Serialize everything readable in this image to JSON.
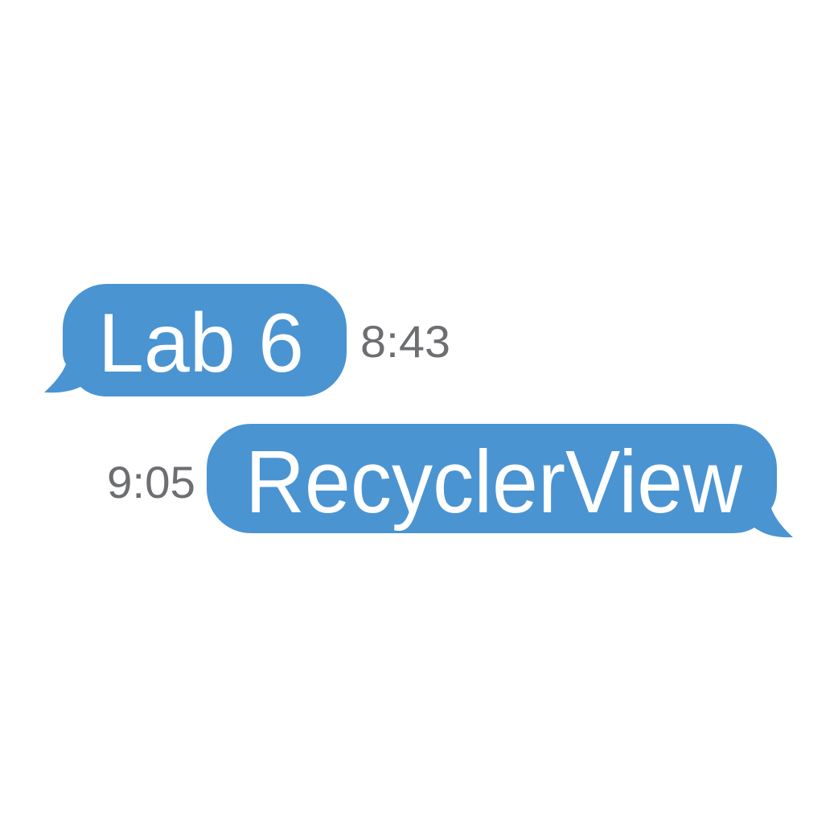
{
  "colors": {
    "bubble": "#4A94D2",
    "bubble_text": "#FFFFFF",
    "timestamp": "#6D6E71",
    "background": "#FFFFFF"
  },
  "messages": [
    {
      "text": "Lab 6",
      "time": "8:43",
      "side": "incoming"
    },
    {
      "text": "RecyclerView",
      "time": "9:05",
      "side": "outgoing"
    }
  ]
}
